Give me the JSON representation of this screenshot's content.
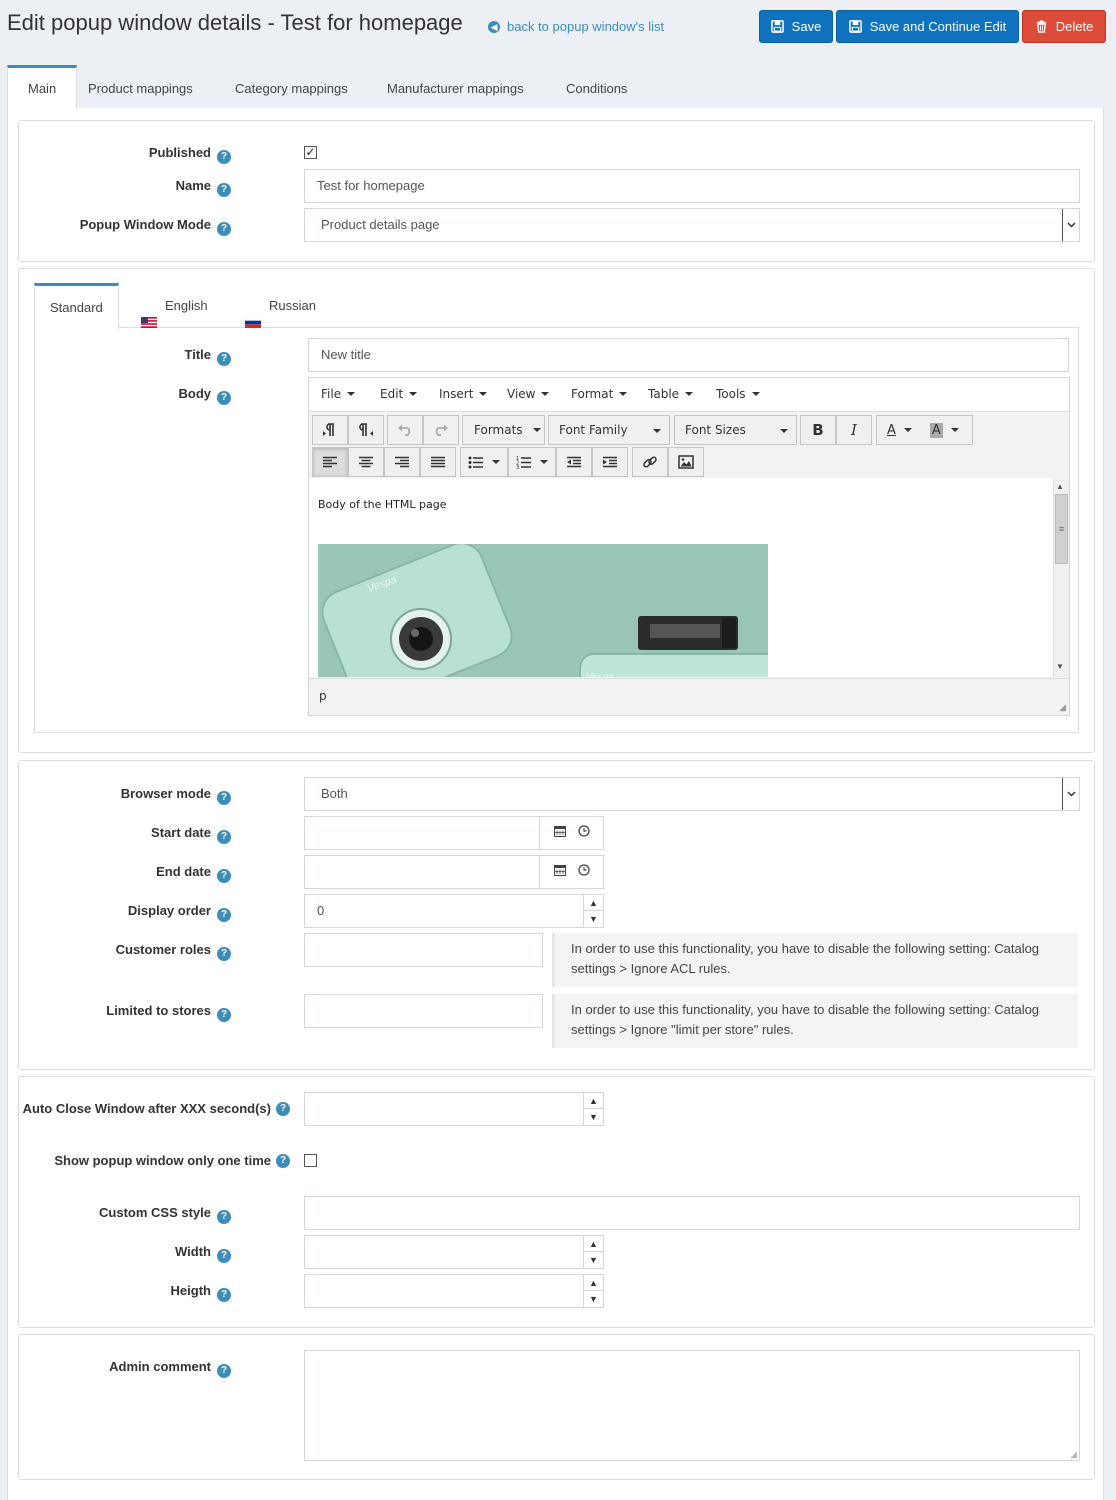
{
  "header": {
    "title": "Edit popup window details - Test for homepage",
    "back_link": "back to popup window's list",
    "save_label": "Save",
    "save_continue_label": "Save and Continue Edit",
    "delete_label": "Delete"
  },
  "tabs": [
    "Main",
    "Product mappings",
    "Category mappings",
    "Manufacturer mappings",
    "Conditions"
  ],
  "general": {
    "published_label": "Published",
    "published_checked": true,
    "name_label": "Name",
    "name_value": "Test for homepage",
    "mode_label": "Popup Window Mode",
    "mode_value": "Product details page"
  },
  "locale_tabs": [
    "Standard",
    "English",
    "Russian"
  ],
  "localized": {
    "title_label": "Title",
    "title_value": "New title",
    "body_label": "Body"
  },
  "editor": {
    "menus": [
      "File",
      "Edit",
      "Insert",
      "View",
      "Format",
      "Table",
      "Tools"
    ],
    "formats_label": "Formats",
    "font_family_label": "Font Family",
    "font_sizes_label": "Font Sizes",
    "body_text": "Body of the HTML page",
    "status_path": "p"
  },
  "schedule": {
    "browser_mode_label": "Browser mode",
    "browser_mode_value": "Both",
    "start_date_label": "Start date",
    "end_date_label": "End date",
    "display_order_label": "Display order",
    "display_order_value": "0",
    "customer_roles_label": "Customer roles",
    "customer_roles_note": "In order to use this functionality, you have to disable the following setting: Catalog settings > Ignore ACL rules.",
    "stores_label": "Limited to stores",
    "stores_note": "In order to use this functionality, you have to disable the following setting: Catalog settings > Ignore \"limit per store\" rules."
  },
  "display": {
    "auto_close_label": "Auto Close Window after XXX second(s)",
    "once_label": "Show popup window only one time",
    "once_checked": false,
    "css_label": "Custom CSS style",
    "width_label": "Width",
    "height_label": "Heigth"
  },
  "comment": {
    "label": "Admin comment"
  },
  "colors": {
    "primary": "#0e72bf",
    "danger": "#dd4b39",
    "accent": "#3c8dbc"
  }
}
